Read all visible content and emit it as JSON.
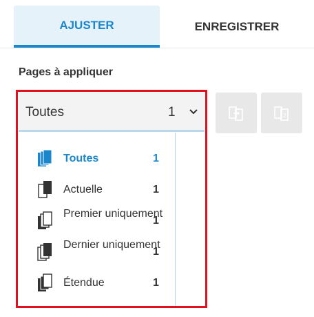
{
  "tabs": [
    {
      "label": "AJUSTER",
      "active": true
    },
    {
      "label": "ENREGISTRER",
      "active": false
    }
  ],
  "section_label": "Pages à appliquer",
  "select": {
    "value": "Toutes",
    "count": "1"
  },
  "options": [
    {
      "label": "Toutes",
      "count": "1",
      "icon": "all-pages-icon",
      "selected": true
    },
    {
      "label": "Actuelle",
      "count": "1",
      "icon": "current-page-icon",
      "selected": false
    },
    {
      "label": "Premier uniquement",
      "count": "1",
      "icon": "first-page-icon",
      "selected": false
    },
    {
      "label": "Dernier uniquement",
      "count": "1",
      "icon": "last-page-icon",
      "selected": false
    },
    {
      "label": "Étendue",
      "count": "1",
      "icon": "range-pages-icon",
      "selected": false
    }
  ],
  "colors": {
    "accent": "#1a86cc",
    "highlight_border": "#e0101f",
    "tab_bg": "#e6f2fa"
  }
}
